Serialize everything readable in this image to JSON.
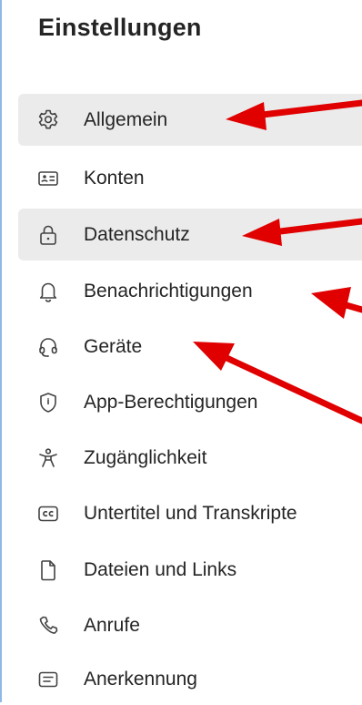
{
  "settings": {
    "title": "Einstellungen",
    "items": [
      {
        "label": "Allgemein",
        "icon": "gear-icon",
        "state": "active"
      },
      {
        "label": "Konten",
        "icon": "id-card-icon",
        "state": "normal"
      },
      {
        "label": "Datenschutz",
        "icon": "lock-icon",
        "state": "hover"
      },
      {
        "label": "Benachrichtigungen",
        "icon": "bell-icon",
        "state": "normal"
      },
      {
        "label": "Geräte",
        "icon": "headset-icon",
        "state": "normal"
      },
      {
        "label": "App-Berechtigungen",
        "icon": "shield-icon",
        "state": "normal"
      },
      {
        "label": "Zugänglichkeit",
        "icon": "accessibility-icon",
        "state": "normal"
      },
      {
        "label": "Untertitel und Transkripte",
        "icon": "closed-captions-icon",
        "state": "normal"
      },
      {
        "label": "Dateien und Links",
        "icon": "file-icon",
        "state": "normal"
      },
      {
        "label": "Anrufe",
        "icon": "phone-icon",
        "state": "normal"
      },
      {
        "label": "Anerkennung",
        "icon": "recognition-icon",
        "state": "normal"
      }
    ]
  },
  "colors": {
    "panel_border": "#8fb8e8",
    "selected_bg": "#ebebeb",
    "text": "#242424",
    "annotation_arrow": "#e00000"
  }
}
